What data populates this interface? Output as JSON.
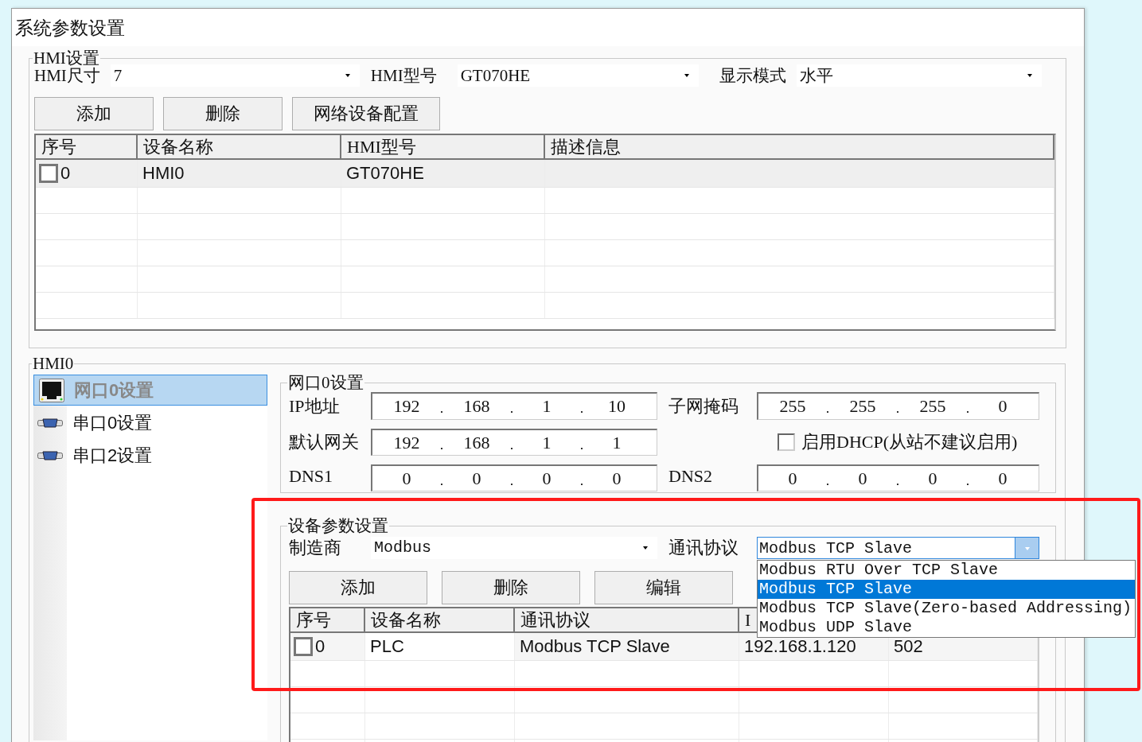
{
  "window": {
    "title": "系统参数设置"
  },
  "hmi_settings": {
    "legend": "HMI设置",
    "fields": [
      {
        "label": "HMI尺寸",
        "value": "7"
      },
      {
        "label": "HMI型号",
        "value": "GT070HE"
      },
      {
        "label": "显示模式",
        "value": "水平"
      }
    ],
    "buttons": [
      "添加",
      "删除",
      "网络设备配置"
    ],
    "table": {
      "columns": [
        "序号",
        "设备名称",
        "HMI型号",
        "描述信息"
      ],
      "rows": [
        {
          "checked": false,
          "cells": [
            "0",
            "HMI0",
            "GT070HE"
          ]
        }
      ]
    }
  },
  "hmi0": {
    "legend": "HMI0",
    "nav": [
      {
        "label": "网口0设置",
        "kind": "ethernet",
        "selected": true
      },
      {
        "label": "串口0设置",
        "kind": "serial",
        "selected": false
      },
      {
        "label": "串口2设置",
        "kind": "serial",
        "selected": false
      }
    ],
    "port": {
      "legend": "网口0设置",
      "ip": {
        "label": "IP地址",
        "octets": [
          "192",
          "168",
          "1",
          "10"
        ]
      },
      "subnet": {
        "label": "子网掩码",
        "octets": [
          "255",
          "255",
          "255",
          "0"
        ]
      },
      "gateway": {
        "label": "默认网关",
        "octets": [
          "192",
          "168",
          "1",
          "1"
        ]
      },
      "dhcp": {
        "label": "启用DHCP(从站不建议启用)",
        "checked": false
      },
      "dns1": {
        "label": "DNS1",
        "octets": [
          "0",
          "0",
          "0",
          "0"
        ]
      },
      "dns2": {
        "label": "DNS2",
        "octets": [
          "0",
          "0",
          "0",
          "0"
        ]
      }
    },
    "device": {
      "legend": "设备参数设置",
      "manufacturer": {
        "label": "制造商",
        "value": "Modbus"
      },
      "protocol": {
        "label": "通讯协议",
        "value": "Modbus TCP Slave",
        "expanded": true,
        "options": [
          {
            "label": "Modbus RTU Over TCP Slave",
            "selected": false
          },
          {
            "label": "Modbus TCP Slave",
            "selected": true
          },
          {
            "label": "Modbus TCP Slave(Zero-based Addressing)",
            "selected": false
          },
          {
            "label": "Modbus UDP Slave",
            "selected": false
          }
        ]
      },
      "buttons": [
        "添加",
        "删除",
        "编辑"
      ],
      "table": {
        "columns": [
          "序号",
          "设备名称",
          "通讯协议",
          "I"
        ],
        "rows": [
          {
            "checked": false,
            "cells": [
              "0",
              "PLC",
              "Modbus TCP Slave",
              "192.168.1.120",
              "502"
            ]
          }
        ]
      }
    }
  }
}
